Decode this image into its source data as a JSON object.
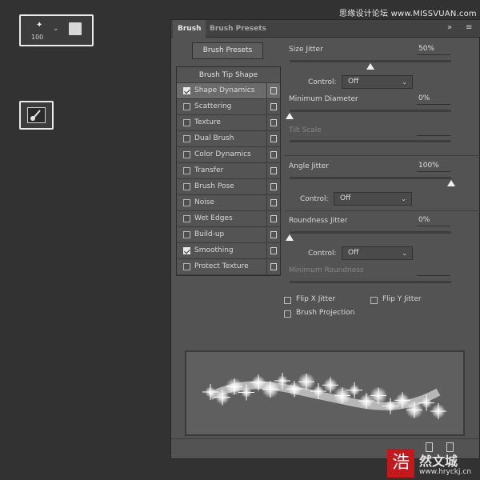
{
  "toolbar": {
    "brush_size": "100"
  },
  "watermark": "思缘设计论坛 www.MISSVUAN.com",
  "panel": {
    "tabs": [
      {
        "label": "Brush"
      },
      {
        "label": "Brush Presets"
      }
    ],
    "presets_button": "Brush Presets",
    "options": {
      "header": "Brush Tip Shape",
      "items": [
        {
          "label": "Shape Dynamics",
          "checked": true,
          "active": true
        },
        {
          "label": "Scattering",
          "checked": false
        },
        {
          "label": "Texture",
          "checked": false
        },
        {
          "label": "Dual Brush",
          "checked": false
        },
        {
          "label": "Color Dynamics",
          "checked": false
        },
        {
          "label": "Transfer",
          "checked": false
        },
        {
          "label": "Brush Pose",
          "checked": false
        },
        {
          "label": "Noise",
          "checked": false
        },
        {
          "label": "Wet Edges",
          "checked": false
        },
        {
          "label": "Build-up",
          "checked": false
        },
        {
          "label": "Smoothing",
          "checked": true
        },
        {
          "label": "Protect Texture",
          "checked": false
        }
      ]
    },
    "size_jitter": {
      "label": "Size Jitter",
      "value": "50%",
      "level": 0.5
    },
    "control_1": {
      "label": "Control:",
      "value": "Off"
    },
    "minimum_diameter": {
      "label": "Minimum Diameter",
      "value": "0%",
      "level": 0
    },
    "tilt_scale": {
      "label": "Tilt Scale"
    },
    "angle_jitter": {
      "label": "Angle Jitter",
      "value": "100%",
      "level": 1.0
    },
    "control_2": {
      "label": "Control:",
      "value": "Off"
    },
    "roundness_jitter": {
      "label": "Roundness Jitter",
      "value": "0%",
      "level": 0
    },
    "control_3": {
      "label": "Control:",
      "value": "Off"
    },
    "minimum_roundness": {
      "label": "Minimum Roundness"
    },
    "flip_x": {
      "label": "Flip X Jitter",
      "checked": false
    },
    "flip_y": {
      "label": "Flip Y Jitter",
      "checked": false
    },
    "brush_projection": {
      "label": "Brush Projection",
      "checked": false
    }
  },
  "logo": {
    "char": "浩",
    "text": "然文城",
    "url": "www.hryckj.cn"
  }
}
